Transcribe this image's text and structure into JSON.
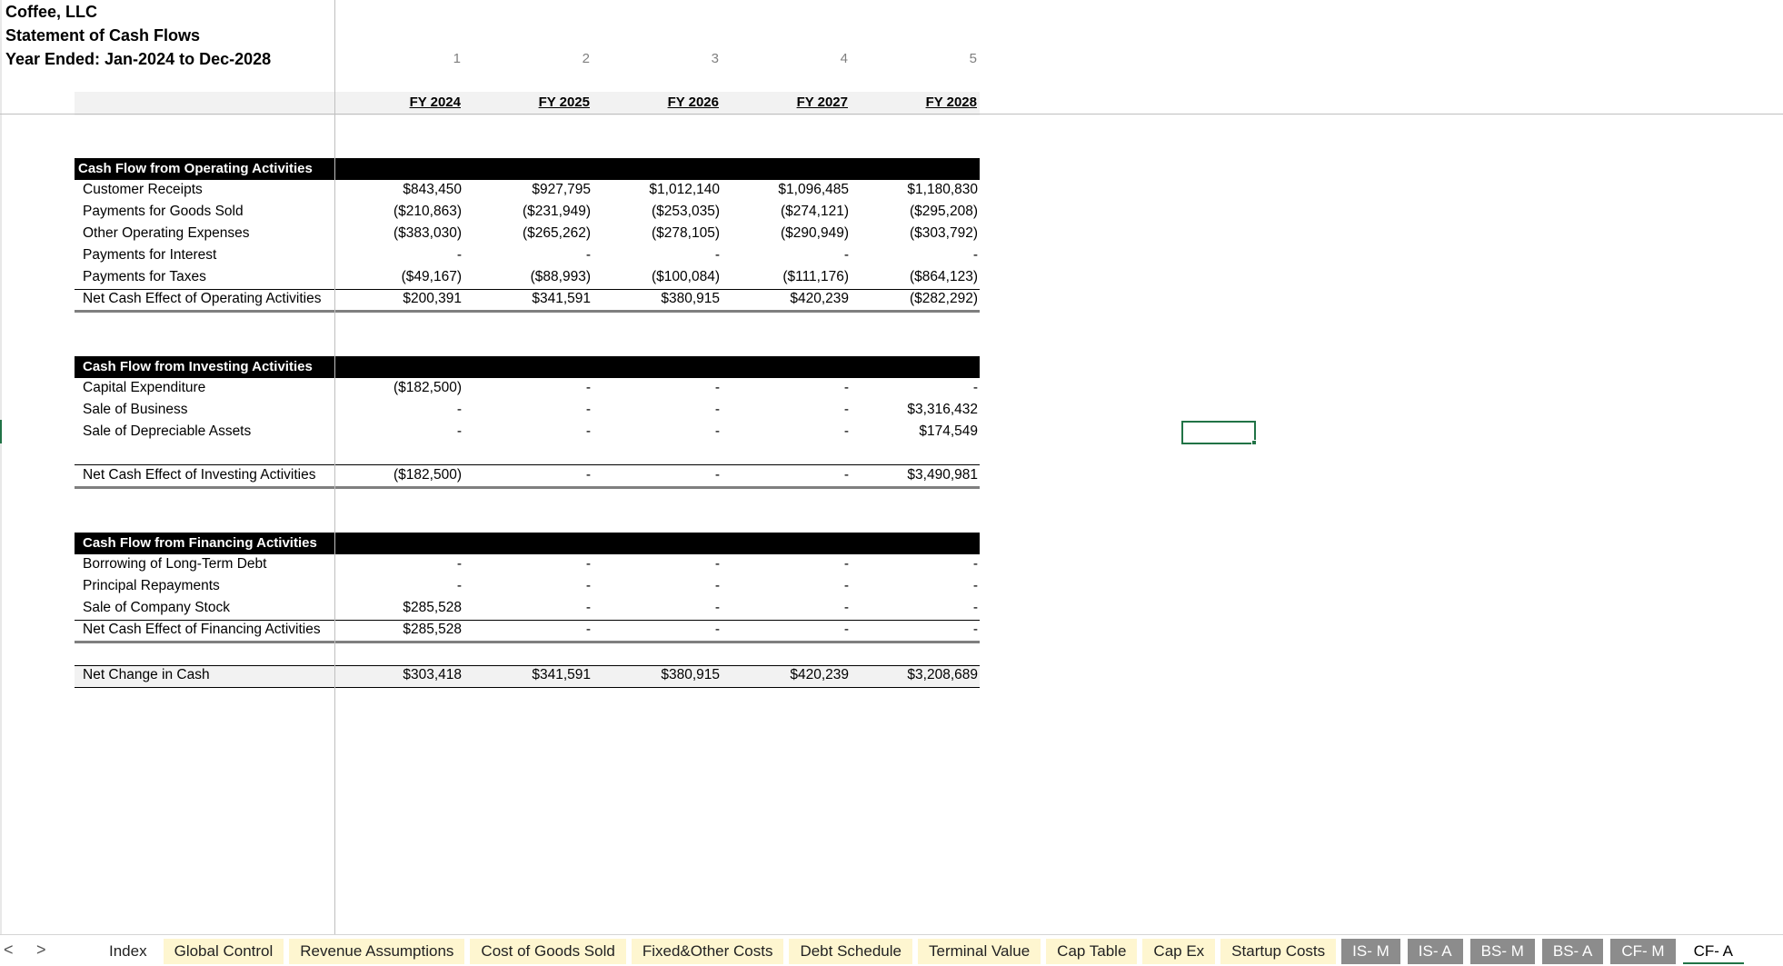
{
  "header": {
    "company": "Coffee, LLC",
    "statement": "Statement of Cash Flows",
    "period": "Year Ended: Jan-2024 to Dec-2028"
  },
  "columns": {
    "numbers": [
      "1",
      "2",
      "3",
      "4",
      "5"
    ],
    "fy": [
      "FY 2024",
      "FY 2025",
      "FY 2026",
      "FY 2027",
      "FY 2028"
    ]
  },
  "operating": {
    "title": "Cash Flow from Operating Activities",
    "rows": [
      {
        "label": "Customer Receipts",
        "values": [
          "$843,450",
          "$927,795",
          "$1,012,140",
          "$1,096,485",
          "$1,180,830"
        ]
      },
      {
        "label": "Payments for Goods Sold",
        "values": [
          "($210,863)",
          "($231,949)",
          "($253,035)",
          "($274,121)",
          "($295,208)"
        ]
      },
      {
        "label": "Other Operating Expenses",
        "values": [
          "($383,030)",
          "($265,262)",
          "($278,105)",
          "($290,949)",
          "($303,792)"
        ]
      },
      {
        "label": "Payments for Interest",
        "values": [
          "-",
          "-",
          "-",
          "-",
          "-"
        ]
      },
      {
        "label": "Payments for Taxes",
        "values": [
          "($49,167)",
          "($88,993)",
          "($100,084)",
          "($111,176)",
          "($864,123)"
        ]
      }
    ],
    "total": {
      "label": "Net Cash Effect of Operating Activities",
      "values": [
        "$200,391",
        "$341,591",
        "$380,915",
        "$420,239",
        "($282,292)"
      ]
    }
  },
  "investing": {
    "title": "Cash Flow from Investing Activities",
    "rows": [
      {
        "label": "Capital Expenditure",
        "values": [
          "($182,500)",
          "-",
          "-",
          "-",
          "-"
        ]
      },
      {
        "label": "Sale of Business",
        "values": [
          "-",
          "-",
          "-",
          "-",
          "$3,316,432"
        ]
      },
      {
        "label": "Sale of Depreciable Assets",
        "values": [
          "-",
          "-",
          "-",
          "-",
          "$174,549"
        ]
      }
    ],
    "total": {
      "label": "Net Cash Effect of Investing Activities",
      "values": [
        "($182,500)",
        "-",
        "-",
        "-",
        "$3,490,981"
      ]
    }
  },
  "financing": {
    "title": "Cash Flow from Financing Activities",
    "rows": [
      {
        "label": "Borrowing of Long-Term Debt",
        "values": [
          "-",
          "-",
          "-",
          "-",
          "-"
        ]
      },
      {
        "label": "Principal Repayments",
        "values": [
          "-",
          "-",
          "-",
          "-",
          "-"
        ]
      },
      {
        "label": "Sale of Company Stock",
        "values": [
          "$285,528",
          "-",
          "-",
          "-",
          "-"
        ]
      }
    ],
    "total": {
      "label": "Net Cash Effect of Financing Activities",
      "values": [
        "$285,528",
        "-",
        "-",
        "-",
        "-"
      ]
    }
  },
  "net_change": {
    "label": "Net Change in Cash",
    "values": [
      "$303,418",
      "$341,591",
      "$380,915",
      "$420,239",
      "$3,208,689"
    ]
  },
  "tabs": [
    {
      "label": "Index",
      "style": "plain"
    },
    {
      "label": "Global Control",
      "style": "yellow"
    },
    {
      "label": "Revenue Assumptions",
      "style": "yellow"
    },
    {
      "label": "Cost of Goods Sold",
      "style": "yellow"
    },
    {
      "label": "Fixed&Other Costs",
      "style": "yellow"
    },
    {
      "label": "Debt Schedule",
      "style": "yellow"
    },
    {
      "label": "Terminal Value",
      "style": "yellow"
    },
    {
      "label": "Cap Table",
      "style": "yellow"
    },
    {
      "label": "Cap Ex",
      "style": "yellow"
    },
    {
      "label": "Startup Costs",
      "style": "yellow"
    },
    {
      "label": "IS- M",
      "style": "gray"
    },
    {
      "label": "IS- A",
      "style": "gray"
    },
    {
      "label": "BS- M",
      "style": "gray"
    },
    {
      "label": "BS- A",
      "style": "gray"
    },
    {
      "label": "CF- M",
      "style": "gray"
    },
    {
      "label": "CF- A",
      "style": "active"
    }
  ],
  "nav": {
    "prev": "<",
    "next": ">"
  }
}
